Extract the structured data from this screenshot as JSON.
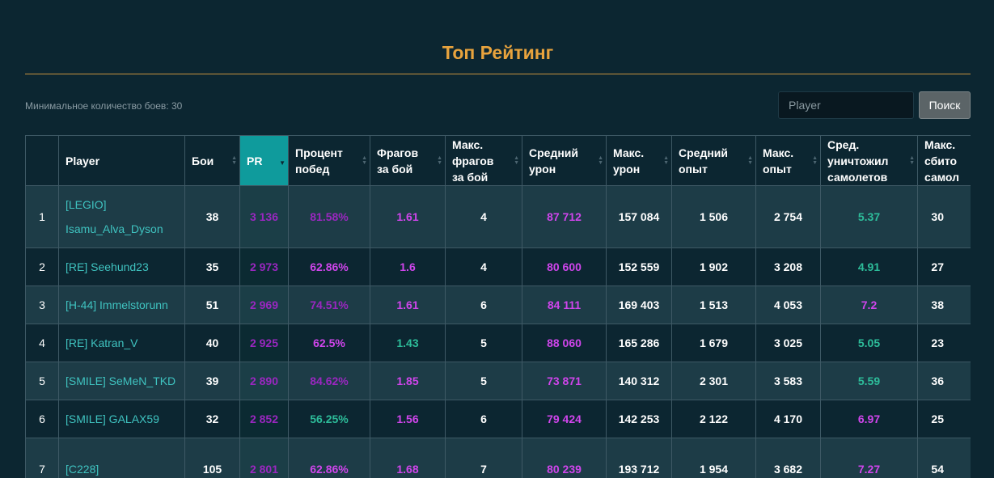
{
  "header": {
    "title": "Топ Рейтинг",
    "min_battles": "Минимальное количество боев: 30"
  },
  "search": {
    "placeholder": "Player",
    "button_label": "Поиск"
  },
  "colors": {
    "title": "#e8a33d",
    "active_sort_column": "#0f9b9c",
    "player_link": "#3fc3c0",
    "purple": "#b534e0",
    "teal": "#2dbd9a"
  },
  "table": {
    "sorted_column": "PR",
    "sort_direction": "desc",
    "columns": [
      {
        "key": "rank",
        "lines": [
          ""
        ]
      },
      {
        "key": "player",
        "lines": [
          "Player"
        ]
      },
      {
        "key": "battles",
        "lines": [
          "Бои"
        ]
      },
      {
        "key": "pr",
        "lines": [
          "PR"
        ]
      },
      {
        "key": "win_rate",
        "lines": [
          "Процент",
          "побед"
        ]
      },
      {
        "key": "frags_per_battle",
        "lines": [
          "Фрагов",
          "за бой"
        ]
      },
      {
        "key": "max_frags",
        "lines": [
          "Макс.",
          "фрагов",
          "за бой"
        ]
      },
      {
        "key": "avg_damage",
        "lines": [
          "Средний",
          "урон"
        ]
      },
      {
        "key": "max_damage",
        "lines": [
          "Макс.",
          "урон"
        ]
      },
      {
        "key": "avg_xp",
        "lines": [
          "Средний",
          "опыт"
        ]
      },
      {
        "key": "max_xp",
        "lines": [
          "Макс.",
          "опыт"
        ]
      },
      {
        "key": "avg_planes",
        "lines": [
          "Сред.",
          "уничтожил",
          "самолетов"
        ]
      },
      {
        "key": "max_planes",
        "lines": [
          "Макс.",
          "сбито",
          "самол"
        ]
      }
    ],
    "rows": [
      {
        "rank": "1",
        "player": [
          "[LEGIO]",
          "Isamu_Alva_Dyson"
        ],
        "battles": "38",
        "pr": "3 136",
        "win_rate": "81.58%",
        "frags": "1.61",
        "max_frags": "4",
        "avg_damage": "87 712",
        "max_damage": "157 084",
        "avg_xp": "1 506",
        "max_xp": "2 754",
        "avg_planes": "5.37",
        "max_planes": "30",
        "tone": {
          "pr": "dpurple",
          "win_rate": "dpurple",
          "frags": "magenta",
          "avg_damage": "magenta",
          "avg_planes": "teal"
        }
      },
      {
        "rank": "2",
        "player": [
          "[RE] Seehund23"
        ],
        "battles": "35",
        "pr": "2 973",
        "win_rate": "62.86%",
        "frags": "1.6",
        "max_frags": "4",
        "avg_damage": "80 600",
        "max_damage": "152 559",
        "avg_xp": "1 902",
        "max_xp": "3 208",
        "avg_planes": "4.91",
        "max_planes": "27",
        "tone": {
          "pr": "dpurple",
          "win_rate": "magenta",
          "frags": "magenta",
          "avg_damage": "magenta",
          "avg_planes": "teal"
        }
      },
      {
        "rank": "3",
        "player": [
          "[H-44] Immelstorunn"
        ],
        "battles": "51",
        "pr": "2 969",
        "win_rate": "74.51%",
        "frags": "1.61",
        "max_frags": "6",
        "avg_damage": "84 111",
        "max_damage": "169 403",
        "avg_xp": "1 513",
        "max_xp": "4 053",
        "avg_planes": "7.2",
        "max_planes": "38",
        "tone": {
          "pr": "dpurple",
          "win_rate": "dpurple",
          "frags": "magenta",
          "avg_damage": "magenta",
          "avg_planes": "magenta"
        }
      },
      {
        "rank": "4",
        "player": [
          "[RE] Katran_V"
        ],
        "battles": "40",
        "pr": "2 925",
        "win_rate": "62.5%",
        "frags": "1.43",
        "max_frags": "5",
        "avg_damage": "88 060",
        "max_damage": "165 286",
        "avg_xp": "1 679",
        "max_xp": "3 025",
        "avg_planes": "5.05",
        "max_planes": "23",
        "tone": {
          "pr": "dpurple",
          "win_rate": "magenta",
          "frags": "teal",
          "avg_damage": "magenta",
          "avg_planes": "teal"
        }
      },
      {
        "rank": "5",
        "player": [
          "[SMILE] SeMeN_TKD"
        ],
        "battles": "39",
        "pr": "2 890",
        "win_rate": "84.62%",
        "frags": "1.85",
        "max_frags": "5",
        "avg_damage": "73 871",
        "max_damage": "140 312",
        "avg_xp": "2 301",
        "max_xp": "3 583",
        "avg_planes": "5.59",
        "max_planes": "36",
        "tone": {
          "pr": "dpurple",
          "win_rate": "dpurple",
          "frags": "magenta",
          "avg_damage": "magenta",
          "avg_planes": "teal"
        }
      },
      {
        "rank": "6",
        "player": [
          "[SMILE] GALAX59"
        ],
        "battles": "32",
        "pr": "2 852",
        "win_rate": "56.25%",
        "frags": "1.56",
        "max_frags": "6",
        "avg_damage": "79 424",
        "max_damage": "142 253",
        "avg_xp": "2 122",
        "max_xp": "4 170",
        "avg_planes": "6.97",
        "max_planes": "25",
        "tone": {
          "pr": "dpurple",
          "win_rate": "teal",
          "frags": "magenta",
          "avg_damage": "magenta",
          "avg_planes": "magenta"
        }
      },
      {
        "rank": "7",
        "player": [
          "[C228]",
          ""
        ],
        "battles": "105",
        "pr": "2 801",
        "win_rate": "62.86%",
        "frags": "1.68",
        "max_frags": "7",
        "avg_damage": "80 239",
        "max_damage": "193 712",
        "avg_xp": "1 954",
        "max_xp": "3 682",
        "avg_planes": "7.27",
        "max_planes": "54",
        "tone": {
          "pr": "dpurple",
          "win_rate": "magenta",
          "frags": "magenta",
          "avg_damage": "magenta",
          "avg_planes": "magenta"
        }
      }
    ]
  }
}
